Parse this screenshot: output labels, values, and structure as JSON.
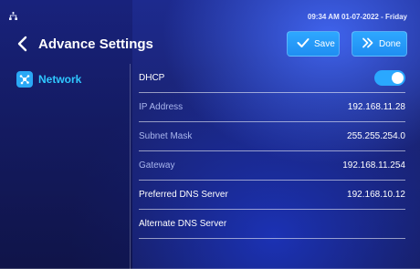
{
  "status_bar": {
    "network_icon": "network-tree-icon",
    "datetime": "09:34 AM  01-07-2022 - Friday"
  },
  "header": {
    "title": "Advance Settings",
    "back_icon": "chevron-left-icon",
    "save_label": "Save",
    "done_label": "Done"
  },
  "sidebar": {
    "items": [
      {
        "label": "Network",
        "icon": "network-icon",
        "selected": true
      }
    ]
  },
  "settings": {
    "dhcp": {
      "label": "DHCP",
      "enabled": true
    },
    "rows": [
      {
        "label": "IP Address",
        "value": "192.168.11.28"
      },
      {
        "label": "Subnet Mask",
        "value": "255.255.254.0"
      },
      {
        "label": "Gateway",
        "value": "192.168.11.254"
      },
      {
        "label": "Preferred DNS Server",
        "value": "192.168.10.12"
      },
      {
        "label": "Alternate DNS Server",
        "value": ""
      }
    ]
  },
  "colors": {
    "accent": "#2aa8ff",
    "sidebar_selected": "#2fc7ff"
  }
}
